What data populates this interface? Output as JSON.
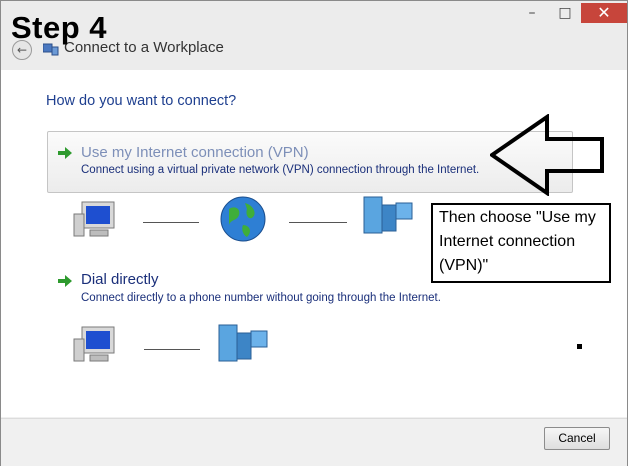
{
  "overlay": {
    "step_label": "Step 4"
  },
  "window": {
    "title": "Connect to a Workplace",
    "controls": {
      "minimize": "–",
      "maximize": "□",
      "close": "✕"
    }
  },
  "prompt": "How do you want to connect?",
  "options": [
    {
      "title": "Use my Internet connection (VPN)",
      "description": "Connect using a virtual private network (VPN) connection through the Internet.",
      "icon": "green-arrow-icon",
      "selected": true
    },
    {
      "title": "Dial directly",
      "description": "Connect directly to a phone number without going through the Internet.",
      "icon": "green-arrow-icon",
      "selected": false
    }
  ],
  "annotation": {
    "callout_text": "Then choose \"Use my Internet connection (VPN)\""
  },
  "footer": {
    "cancel_label": "Cancel"
  },
  "colors": {
    "prompt": "#1e3f8f",
    "option_title_selected": "#7d8fb8",
    "option_title": "#1a2f7a",
    "close_button": "#c7453b",
    "arrow_green": "#2e9a2e"
  }
}
